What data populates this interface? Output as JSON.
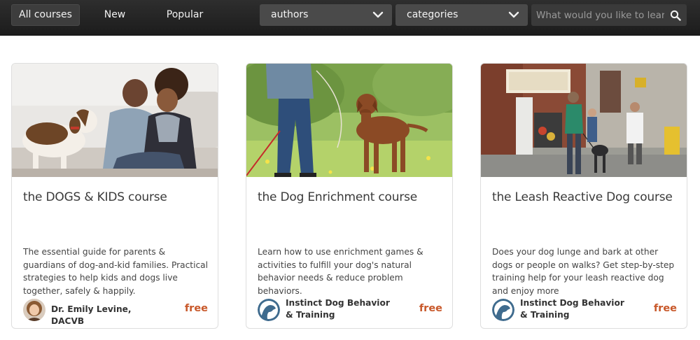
{
  "nav": {
    "tabs": [
      {
        "label": "All courses",
        "active": true
      },
      {
        "label": "New",
        "active": false
      },
      {
        "label": "Popular",
        "active": false
      }
    ],
    "authors_dropdown": {
      "selected": "authors",
      "icon": "chevron-down-icon"
    },
    "categories_dropdown": {
      "selected": "categories",
      "icon": "chevron-down-icon"
    },
    "search": {
      "placeholder": "What would you like to learn?",
      "value": "",
      "icon": "search-icon"
    }
  },
  "courses": [
    {
      "title": "the DOGS & KIDS course",
      "description": "The essential guide for parents & guardians of dog-and-kid families. Practical strategies to help kids and dogs live together, safely & happily.",
      "author": "Dr. Emily Levine, DACVB",
      "price": "free"
    },
    {
      "title": "the Dog Enrichment course",
      "description": "Learn how to use enrichment games & activities to fulfill your dog's natural behavior needs & reduce problem behaviors.",
      "author": "Instinct Dog Behavior & Training",
      "price": "free"
    },
    {
      "title": "the Leash Reactive Dog course",
      "description": "Does your dog lunge and bark at other dogs or people on walks? Get step-by-step training help for your leash reactive dog and enjoy more",
      "author": "Instinct Dog Behavior & Training",
      "price": "free"
    }
  ],
  "colors": {
    "topbar": "#232323",
    "dropdown": "#4a4a4a",
    "price": "#c8582a",
    "instinct_logo": "#3f6b8e"
  }
}
